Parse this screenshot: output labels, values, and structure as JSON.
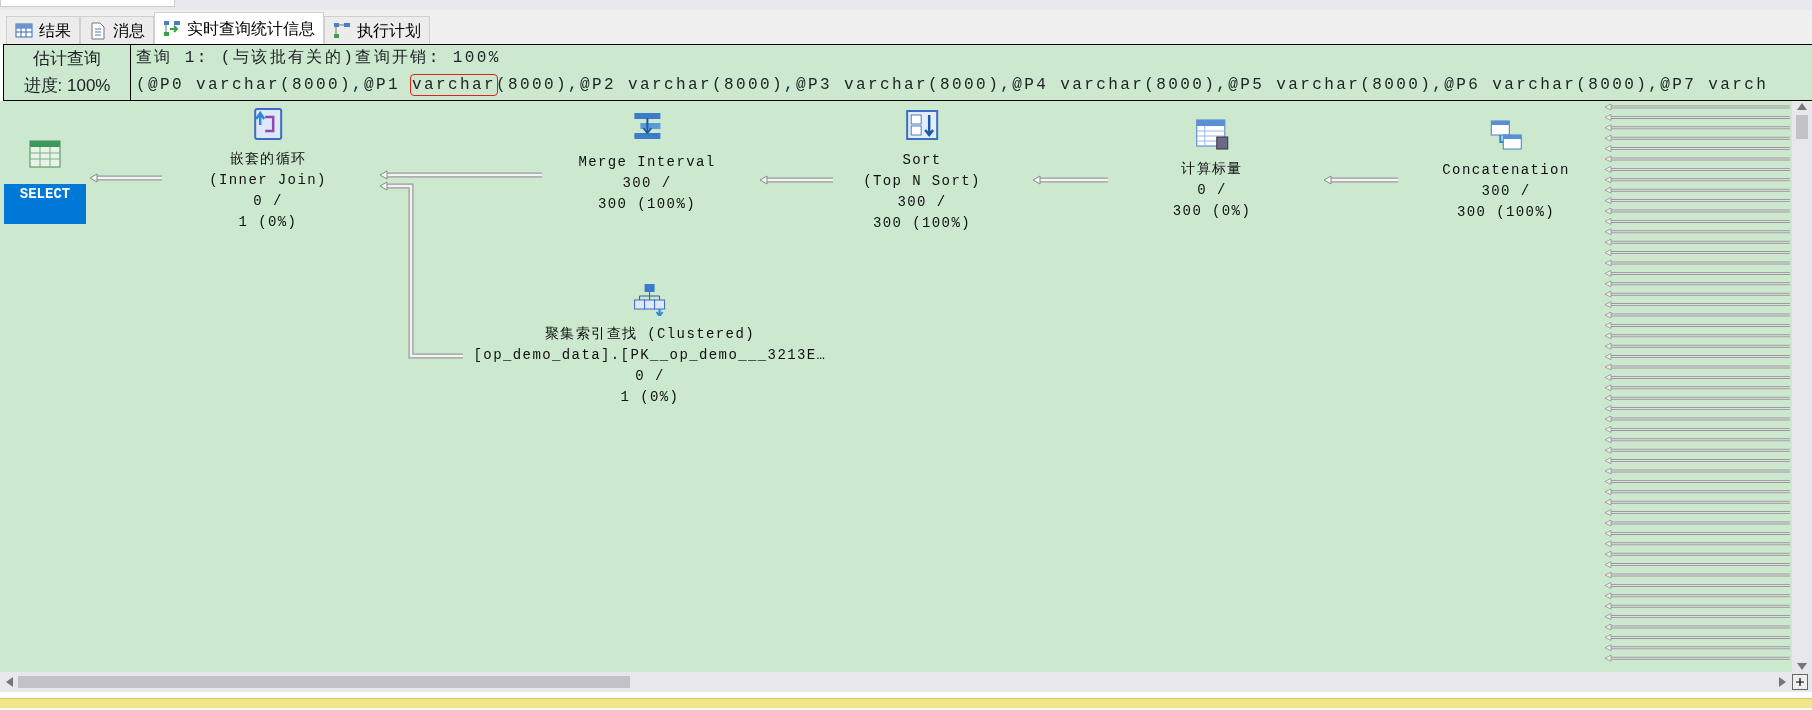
{
  "tabs": [
    {
      "label": "结果",
      "kind": "grid",
      "selected": false
    },
    {
      "label": "消息",
      "kind": "document",
      "selected": false
    },
    {
      "label": "实时查询统计信息",
      "kind": "stats",
      "selected": true
    },
    {
      "label": "执行计划",
      "kind": "plan",
      "selected": false
    }
  ],
  "header": {
    "progress_title": "估计查询",
    "progress_value": "进度: 100%",
    "query_title": "查询 1: (与该批有关的)查询开销: 100%",
    "params": [
      {
        "text": "(@P0 varchar(8000),@P1 ",
        "highlighted": false
      },
      {
        "text": "varchar",
        "highlighted": true
      },
      {
        "text": "(8000),@P2 varchar(8000),@P3 varchar(8000),@P4 varchar(8000),@P5 varchar(8000),@P6 varchar(8000),@P7 varch",
        "highlighted": false
      }
    ]
  },
  "plan": {
    "nodes": [
      {
        "kind": "select",
        "lines": [
          "SELECT"
        ],
        "selected": true
      },
      {
        "kind": "nested_loops",
        "lines": [
          "嵌套的循环",
          "(Inner Join)",
          "0 /",
          "1 (0%)"
        ],
        "selected": false
      },
      {
        "kind": "merge_interval",
        "lines": [
          "Merge Interval",
          "300 /",
          "300 (100%)"
        ],
        "selected": false
      },
      {
        "kind": "sort",
        "lines": [
          "Sort",
          "(Top N Sort)",
          "300 /",
          "300 (100%)"
        ],
        "selected": false
      },
      {
        "kind": "compute_scalar",
        "lines": [
          "计算标量",
          "0 /",
          "300 (0%)"
        ],
        "selected": false
      },
      {
        "kind": "concatenation",
        "lines": [
          "Concatenation",
          "300 /",
          "300 (100%)"
        ],
        "selected": false
      },
      {
        "kind": "clustered_index_seek",
        "lines": [
          "聚集索引查找 (Clustered)",
          "[op_demo_data].[PK__op_demo___3213E…",
          "0 /",
          "1 (0%)"
        ],
        "selected": false
      }
    ]
  }
}
